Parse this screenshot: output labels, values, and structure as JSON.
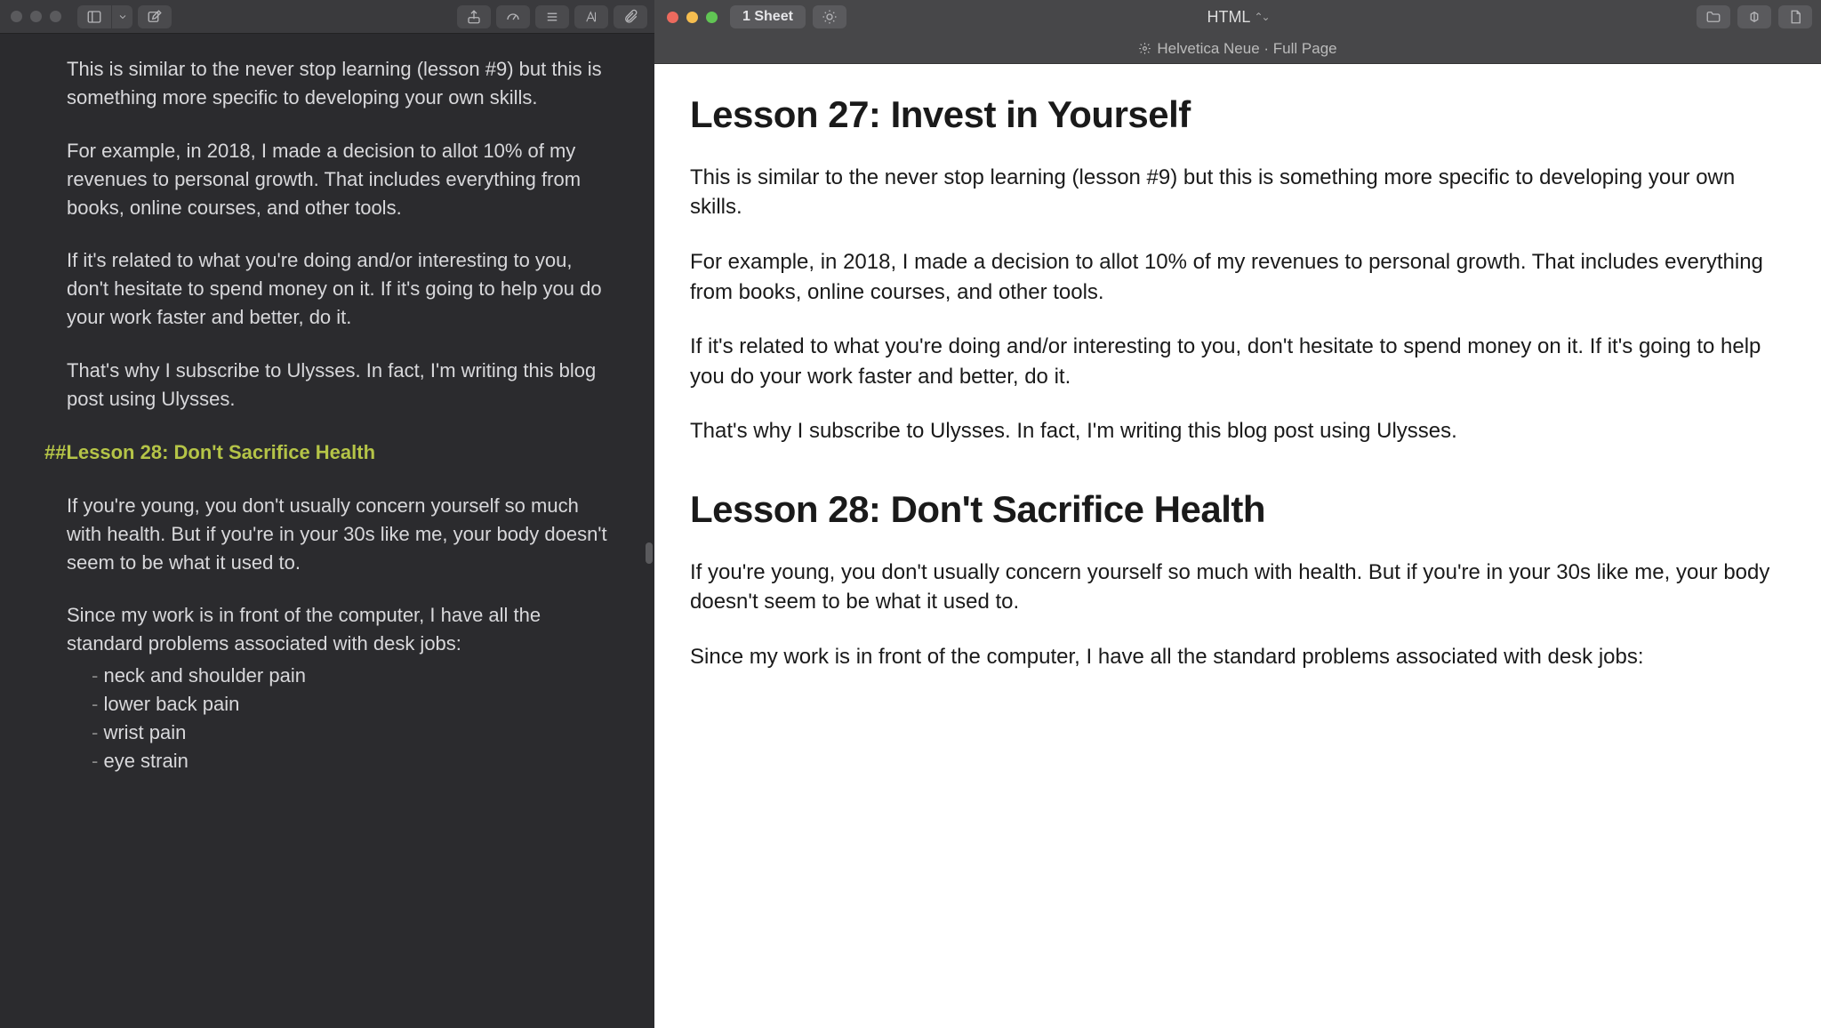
{
  "left": {
    "paragraphs": {
      "p1": "This is similar to the never stop learning (lesson #9) but this is something more specific to developing your own skills.",
      "p2": "For example, in 2018, I made a decision to allot 10% of my revenues to personal growth. That includes everything from books, online courses, and other tools.",
      "p3": "If it's related to what you're doing and/or interesting to you, don't hesitate to spend money on it. If it's going to help you do your work faster and better, do it.",
      "p4": "That's why I subscribe to Ulysses. In fact, I'm writing this blog post using Ulysses."
    },
    "heading28": "##Lesson 28: Don't Sacrifice Health",
    "after28": {
      "p1": "If you're young, you don't usually concern yourself so much with health. But if you're in your 30s like me, your body doesn't seem to be what it used to.",
      "p2": "Since my work is in front of the computer, I have all the standard problems associated with desk jobs:"
    },
    "list": {
      "marker": "-",
      "item1": "neck and shoulder pain",
      "item2": "lower back pain",
      "item3": "wrist pain",
      "item4": "eye strain"
    }
  },
  "right": {
    "sheet_label": "1 Sheet",
    "format_label": "HTML",
    "subbar": "Helvetica Neue · Full Page",
    "h27": "Lesson 27: Invest in Yourself",
    "p1": "This is similar to the never stop learning (lesson #9) but this is something more specific to developing your own skills.",
    "p2": "For example, in 2018, I made a decision to allot 10% of my revenues to personal growth. That includes everything from books, online courses, and other tools.",
    "p3": "If it's related to what you're doing and/or interesting to you, don't hesitate to spend money on it. If it's going to help you do your work faster and better, do it.",
    "p4": "That's why I subscribe to Ulysses. In fact, I'm writing this blog post using Ulysses.",
    "h28": "Lesson 28: Don't Sacrifice Health",
    "p5": "If you're young, you don't usually concern yourself so much with health. But if you're in your 30s like me, your body doesn't seem to be what it used to.",
    "p6": "Since my work is in front of the computer, I have all the standard problems associated with desk jobs:"
  }
}
